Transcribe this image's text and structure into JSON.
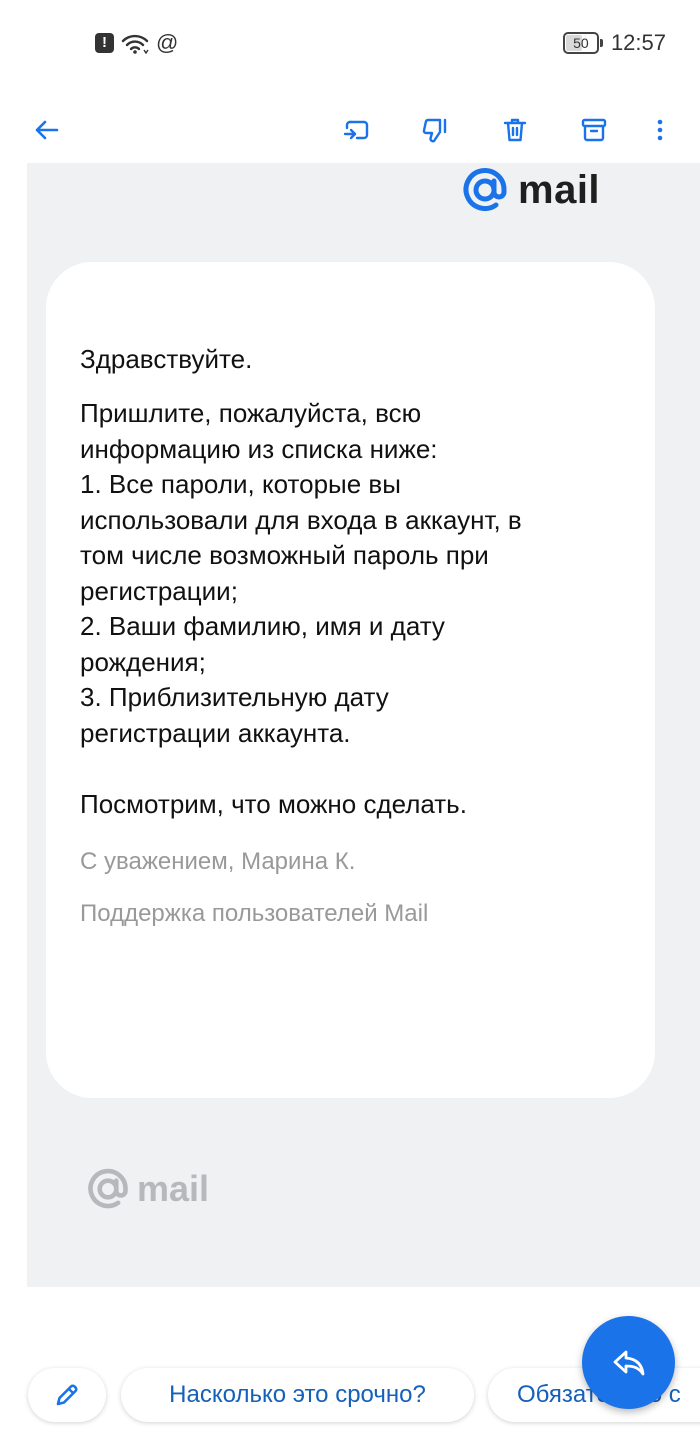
{
  "status_bar": {
    "alert_glyph": "!",
    "at_glyph": "@",
    "battery_level": "50",
    "time": "12:57"
  },
  "toolbar": {
    "icons": [
      "back-arrow-icon",
      "move-to-folder-icon",
      "spam-icon",
      "delete-icon",
      "archive-icon",
      "more-vertical-icon"
    ]
  },
  "email": {
    "logo_top_text": "mail",
    "greeting": "Здравствуйте.",
    "body_lines": [
      "Пришлите, пожалуйста, всю",
      "информацию из списка ниже:",
      "1. Все пароли, которые вы",
      "использовали для входа в аккаунт, в",
      "том числе возможный пароль при",
      "регистрации;",
      "2. Ваши фамилию, имя и дату",
      "рождения;",
      "3. Приблизительную дату",
      "регистрации аккаунта."
    ],
    "closing": "Посмотрим, что можно сделать.",
    "signature": "С уважением, Марина К.",
    "team": "Поддержка пользователей Mail",
    "logo_bottom_text": "mail"
  },
  "quick_replies": {
    "chip_1": "Насколько это срочно?",
    "chip_2": "Обязательно с"
  },
  "colors": {
    "accent": "#1a73e8",
    "chip_text": "#1560b8",
    "frame_bg": "#f0f1f3"
  }
}
